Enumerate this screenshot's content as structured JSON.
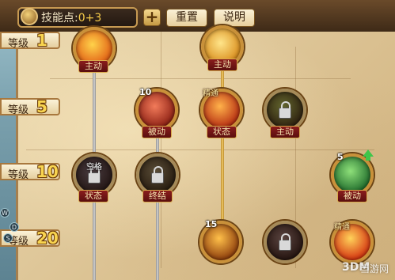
{
  "header": {
    "skill_points_label": "技能点:",
    "skill_points_value": "0+3",
    "plus_label": "+",
    "reset_label": "重置",
    "help_label": "说明"
  },
  "levels": [
    {
      "label": "等级",
      "number": "1"
    },
    {
      "label": "等级",
      "number": "5"
    },
    {
      "label": "等级",
      "number": "10"
    },
    {
      "label": "等级",
      "number": "20"
    }
  ],
  "skills": [
    {
      "id": "fire-orb",
      "type": "主动",
      "locked": false,
      "colors": [
        "#ffd24a",
        "#e05a12"
      ]
    },
    {
      "id": "golden-flame",
      "type": "主动",
      "locked": false,
      "colors": [
        "#ffe58a",
        "#d88a18"
      ]
    },
    {
      "id": "power-fist",
      "type": "被动",
      "level": "10",
      "locked": false,
      "colors": [
        "#f27b5a",
        "#8a1e12"
      ]
    },
    {
      "id": "flame-burst",
      "type": "状态",
      "mastered_label": "精通",
      "locked": false,
      "colors": [
        "#ffb24a",
        "#b42a10"
      ]
    },
    {
      "id": "earth-slash",
      "type": "主动",
      "locked": true,
      "colors": [
        "#9aa84a",
        "#3a2a14"
      ]
    },
    {
      "id": "void-strike",
      "type": "状态",
      "top_label": "空格",
      "locked": true,
      "colors": [
        "#6a5a6a",
        "#2a1a1e"
      ]
    },
    {
      "id": "finisher",
      "type": "终结",
      "locked": true,
      "colors": [
        "#8a7a5a",
        "#2e2214"
      ]
    },
    {
      "id": "nature-shield",
      "type": "被动",
      "level": "5",
      "upgradable": true,
      "locked": false,
      "colors": [
        "#8ee07a",
        "#1e6a2a"
      ]
    },
    {
      "id": "inferno-wave",
      "level": "15",
      "locked": false,
      "colors": [
        "#ffc04a",
        "#8a3a0a"
      ]
    },
    {
      "id": "shadow-flame",
      "locked": true,
      "colors": [
        "#8a6a6a",
        "#2a1414"
      ]
    },
    {
      "id": "phoenix-blaze",
      "mastered_label": "精通",
      "locked": false,
      "colors": [
        "#ffd25a",
        "#d4300e"
      ]
    }
  ],
  "side_keys": [
    "W",
    "D",
    "S"
  ],
  "watermark": {
    "logo": "3DM",
    "text": "当游网"
  }
}
